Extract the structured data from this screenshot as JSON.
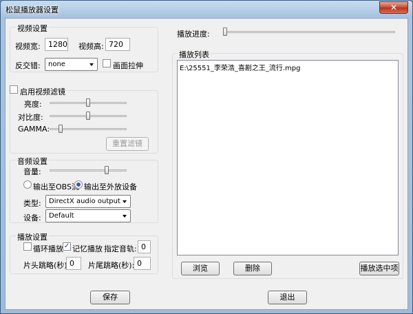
{
  "window": {
    "title": "松鼠播放器设置",
    "close_label": "✕"
  },
  "video": {
    "group_title": "视频设置",
    "width_label": "视频宽:",
    "width_value": "1280",
    "height_label": "视频高:",
    "height_value": "720",
    "deinterlace_label": "反交错:",
    "deinterlace_value": "none",
    "stretch_label": "画面拉伸"
  },
  "filter": {
    "enable_label": "启用视频滤镜",
    "brightness_label": "亮度:",
    "contrast_label": "对比度:",
    "gamma_label": "GAMMA:",
    "brightness_level": 0.5,
    "contrast_level": 0.5,
    "gamma_level": 0.12,
    "reset_label": "重置滤镜"
  },
  "audio": {
    "group_title": "音频设置",
    "volume_label": "音量:",
    "volume_level": 0.75,
    "output_obs_label": "输出至OBS流",
    "output_device_label": "输出至外放设备",
    "type_label": "类型:",
    "type_value": "DirectX audio output",
    "device_label": "设备:",
    "device_value": "Default"
  },
  "playback": {
    "group_title": "播放设置",
    "loop_label": "循环播放",
    "remember_label": "记忆播放",
    "audio_track_label": "指定音轨:",
    "audio_track_value": "0",
    "skip_head_label": "片头跳略(秒):",
    "skip_head_value": "0",
    "skip_tail_label": "片尾跳略(秒):",
    "skip_tail_value": "0"
  },
  "progress": {
    "label": "播放进度:",
    "level": 0.0
  },
  "playlist": {
    "group_title": "播放列表",
    "items": [
      "E:\\25551_李荣浩_喜剧之王_流行.mpg"
    ],
    "browse_label": "浏览",
    "delete_label": "删除",
    "play_selected_label": "播放选中项"
  },
  "footer": {
    "save_label": "保存",
    "exit_label": "退出"
  }
}
